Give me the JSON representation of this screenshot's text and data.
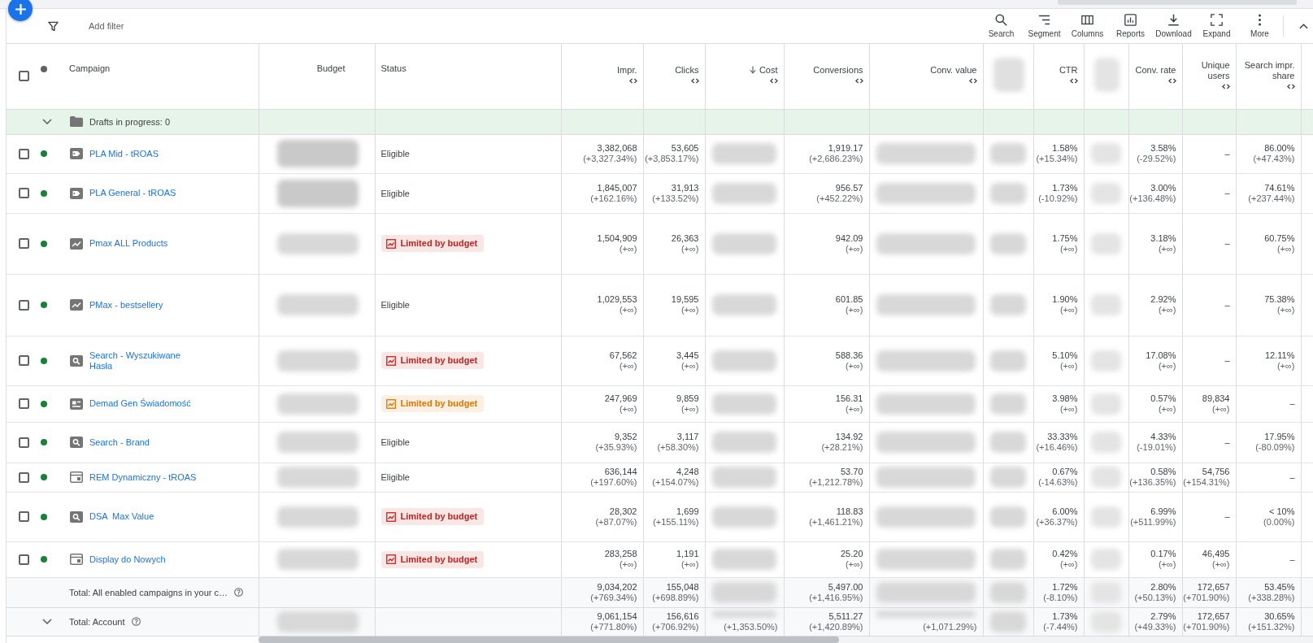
{
  "toolbar": {
    "filter": {
      "placeholder": "Add filter"
    },
    "actions": [
      {
        "kind": "search",
        "label": "Search"
      },
      {
        "kind": "segment",
        "label": "Segment"
      },
      {
        "kind": "columns",
        "label": "Columns"
      },
      {
        "kind": "reports",
        "label": "Reports"
      },
      {
        "kind": "download",
        "label": "Download"
      },
      {
        "kind": "expand",
        "label": "Expand"
      },
      {
        "kind": "more",
        "label": "More"
      }
    ]
  },
  "table": {
    "select_all": {
      "checked": false
    },
    "fixed_columns": [
      "Campaign",
      "Budget",
      "Status"
    ],
    "metric_columns": [
      {
        "label": "Impr.",
        "sorted": false
      },
      {
        "label": "Clicks",
        "sorted": false
      },
      {
        "label": "Cost",
        "sorted": true
      },
      {
        "label": "Conversions",
        "sorted": false
      },
      {
        "label": "Conv. value",
        "sorted": false
      },
      {
        "blurred": true
      },
      {
        "label": "CTR",
        "sorted": false
      },
      {
        "blurred": true
      },
      {
        "label": "Conv. rate",
        "sorted": false
      },
      {
        "label": "Unique users",
        "sorted": false
      },
      {
        "label": "Search impr. share",
        "sorted": false
      }
    ],
    "drafts": {
      "label": "Drafts in progress: 0"
    },
    "rows": [
      {
        "checked": false,
        "enabled": true,
        "kind": "shopping",
        "name": "PLA Mid - tROAS",
        "budget": {
          "blurred": true
        },
        "status": {
          "kind": "text",
          "text": "Eligible"
        },
        "metrics": [
          {
            "value": "3,382,068",
            "change": "(+3,327.34%)"
          },
          {
            "value": "53,605",
            "change": "(+3,853.17%)"
          },
          {
            "blurred": true
          },
          {
            "value": "1,919.17",
            "change": "(+2,686.23%)"
          },
          {
            "blurred": true
          },
          {
            "blurred": true
          },
          {
            "value": "1.58%",
            "change": "(+15.34%)"
          },
          {
            "blurred": true
          },
          {
            "value": "3.58%",
            "change": "(-29.52%)"
          },
          {
            "value": "–"
          },
          {
            "value": "86.00%",
            "change": "(+47.43%)"
          }
        ]
      },
      {
        "checked": false,
        "enabled": true,
        "kind": "shopping",
        "name": "PLA General - tROAS",
        "budget": {
          "blurred": true
        },
        "status": {
          "kind": "text",
          "text": "Eligible"
        },
        "metrics": [
          {
            "value": "1,845,007",
            "change": "(+162.16%)"
          },
          {
            "value": "31,913",
            "change": "(+133.52%)"
          },
          {
            "blurred": true
          },
          {
            "value": "956.57",
            "change": "(+452.22%)"
          },
          {
            "blurred": true
          },
          {
            "blurred": true
          },
          {
            "value": "1.73%",
            "change": "(-10.92%)"
          },
          {
            "blurred": true
          },
          {
            "value": "3.00%",
            "change": "(+136.48%)"
          },
          {
            "value": "–"
          },
          {
            "value": "74.61%",
            "change": "(+237.44%)"
          }
        ]
      },
      {
        "checked": false,
        "enabled": true,
        "kind": "performance_max",
        "name": "Pmax ALL Products",
        "budget": {
          "blurred": true
        },
        "status": {
          "kind": "badge",
          "text": "Limited by budget",
          "color": "#c5221f"
        },
        "metrics": [
          {
            "value": "1,504,909",
            "change": "(+∞)"
          },
          {
            "value": "26,363",
            "change": "(+∞)"
          },
          {
            "blurred": true
          },
          {
            "value": "942.09",
            "change": "(+∞)"
          },
          {
            "blurred": true
          },
          {
            "blurred": true
          },
          {
            "value": "1.75%",
            "change": "(+∞)"
          },
          {
            "blurred": true
          },
          {
            "value": "3.18%",
            "change": "(+∞)"
          },
          {
            "value": "–"
          },
          {
            "value": "60.75%",
            "change": "(+∞)"
          }
        ]
      },
      {
        "checked": false,
        "enabled": true,
        "kind": "performance_max",
        "name": "PMax - bestsellery",
        "budget": {
          "blurred": true
        },
        "status": {
          "kind": "text",
          "text": "Eligible"
        },
        "metrics": [
          {
            "value": "1,029,553",
            "change": "(+∞)"
          },
          {
            "value": "19,595",
            "change": "(+∞)"
          },
          {
            "blurred": true
          },
          {
            "value": "601.85",
            "change": "(+∞)"
          },
          {
            "blurred": true
          },
          {
            "blurred": true
          },
          {
            "value": "1.90%",
            "change": "(+∞)"
          },
          {
            "blurred": true
          },
          {
            "value": "2.92%",
            "change": "(+∞)"
          },
          {
            "value": "–"
          },
          {
            "value": "75.38%",
            "change": "(+∞)"
          }
        ]
      },
      {
        "checked": false,
        "enabled": true,
        "kind": "search",
        "name": "Search - Wyszukiwane Hasła",
        "budget": {
          "blurred": true
        },
        "status": {
          "kind": "badge",
          "text": "Limited by budget",
          "color": "#c5221f"
        },
        "metrics": [
          {
            "value": "67,562",
            "change": "(+∞)"
          },
          {
            "value": "3,445",
            "change": "(+∞)"
          },
          {
            "blurred": true
          },
          {
            "value": "588.36",
            "change": "(+∞)"
          },
          {
            "blurred": true
          },
          {
            "blurred": true
          },
          {
            "value": "5.10%",
            "change": "(+∞)"
          },
          {
            "blurred": true
          },
          {
            "value": "17.08%",
            "change": "(+∞)"
          },
          {
            "value": "–"
          },
          {
            "value": "12.11%",
            "change": "(+∞)"
          }
        ]
      },
      {
        "checked": false,
        "enabled": true,
        "kind": "demand_gen",
        "name": "Demad Gen Świadomość",
        "budget": {
          "blurred": true
        },
        "status": {
          "kind": "badge",
          "text": "Limited by budget",
          "color": "#e37400"
        },
        "metrics": [
          {
            "value": "247,969",
            "change": "(+∞)"
          },
          {
            "value": "9,859",
            "change": "(+∞)"
          },
          {
            "blurred": true
          },
          {
            "value": "156.31",
            "change": "(+∞)"
          },
          {
            "blurred": true
          },
          {
            "blurred": true
          },
          {
            "value": "3.98%",
            "change": "(+∞)"
          },
          {
            "blurred": true
          },
          {
            "value": "0.57%",
            "change": "(+∞)"
          },
          {
            "value": "89,834",
            "change": "(+∞)"
          },
          {
            "value": "–"
          }
        ]
      },
      {
        "checked": false,
        "enabled": true,
        "kind": "search",
        "name": "Search - Brand",
        "budget": {
          "blurred": true
        },
        "status": {
          "kind": "text",
          "text": "Eligible"
        },
        "metrics": [
          {
            "value": "9,352",
            "change": "(+35.93%)"
          },
          {
            "value": "3,117",
            "change": "(+58.30%)"
          },
          {
            "blurred": true
          },
          {
            "value": "134.92",
            "change": "(+28.21%)"
          },
          {
            "blurred": true
          },
          {
            "blurred": true
          },
          {
            "value": "33.33%",
            "change": "(+16.46%)"
          },
          {
            "blurred": true
          },
          {
            "value": "4.33%",
            "change": "(-19.01%)"
          },
          {
            "value": "–"
          },
          {
            "value": "17.95%",
            "change": "(-80.09%)"
          }
        ]
      },
      {
        "checked": false,
        "enabled": true,
        "kind": "display",
        "name": "REM Dynamiczny - tROAS",
        "budget": {
          "blurred": true
        },
        "status": {
          "kind": "text",
          "text": "Eligible"
        },
        "metrics": [
          {
            "value": "636,144",
            "change": "(+197.60%)"
          },
          {
            "value": "4,248",
            "change": "(+154.07%)"
          },
          {
            "blurred": true
          },
          {
            "value": "53.70",
            "change": "(+1,212.78%)"
          },
          {
            "blurred": true
          },
          {
            "blurred": true
          },
          {
            "value": "0.67%",
            "change": "(-14.63%)"
          },
          {
            "blurred": true
          },
          {
            "value": "0.58%",
            "change": "(+136.35%)"
          },
          {
            "value": "54,756",
            "change": "(+154.31%)"
          },
          {
            "value": "–"
          }
        ]
      },
      {
        "checked": false,
        "enabled": true,
        "kind": "search",
        "name": "DSA  Max Value",
        "budget": {
          "blurred": true
        },
        "status": {
          "kind": "badge",
          "text": "Limited by budget",
          "color": "#c5221f"
        },
        "metrics": [
          {
            "value": "28,302",
            "change": "(+87.07%)"
          },
          {
            "value": "1,699",
            "change": "(+155.11%)"
          },
          {
            "blurred": true
          },
          {
            "value": "118.83",
            "change": "(+1,461.21%)"
          },
          {
            "blurred": true
          },
          {
            "blurred": true
          },
          {
            "value": "6.00%",
            "change": "(+36.37%)"
          },
          {
            "blurred": true
          },
          {
            "value": "6.99%",
            "change": "(+511.99%)"
          },
          {
            "value": "–"
          },
          {
            "value": "< 10%",
            "change": "(0.00%)"
          }
        ]
      },
      {
        "checked": false,
        "enabled": true,
        "kind": "display",
        "name": "Display do Nowych",
        "budget": {
          "blurred": true
        },
        "status": {
          "kind": "badge",
          "text": "Limited by budget",
          "color": "#c5221f"
        },
        "metrics": [
          {
            "value": "283,258",
            "change": "(+∞)"
          },
          {
            "value": "1,191",
            "change": "(+∞)"
          },
          {
            "blurred": true
          },
          {
            "value": "25.20",
            "change": "(+∞)"
          },
          {
            "blurred": true
          },
          {
            "blurred": true
          },
          {
            "value": "0.42%",
            "change": "(+∞)"
          },
          {
            "blurred": true
          },
          {
            "value": "0.17%",
            "change": "(+∞)"
          },
          {
            "value": "46,495",
            "change": "(+∞)"
          },
          {
            "value": "–"
          }
        ]
      }
    ],
    "totals": [
      {
        "kind": "enabled",
        "label": "Total: All enabled campaigns in your c…",
        "metrics": [
          {
            "value": "9,034,202",
            "change": "(+769.34%)"
          },
          {
            "value": "155,048",
            "change": "(+698.89%)"
          },
          {
            "blurred": true
          },
          {
            "value": "5,497.00",
            "change": "(+1,416.95%)"
          },
          {
            "blurred": true
          },
          {
            "blurred": true
          },
          {
            "value": "1.72%",
            "change": "(-8.10%)"
          },
          {
            "blurred": true
          },
          {
            "value": "2.80%",
            "change": "(+50.13%)"
          },
          {
            "value": "172,657",
            "change": "(+701.90%)"
          },
          {
            "value": "53.45%",
            "change": "(+338.28%)"
          }
        ]
      },
      {
        "kind": "account",
        "label": "Total: Account",
        "budget": {
          "blurred": true
        },
        "metrics": [
          {
            "value": "9,061,154",
            "change": "(+771.80%)"
          },
          {
            "value": "156,616",
            "change": "(+706.92%)"
          },
          {
            "blurred": true,
            "change": "(+1,353.50%)"
          },
          {
            "value": "5,511.27",
            "change": "(+1,420.89%)"
          },
          {
            "blurred": true,
            "change": "(+1,071.29%)"
          },
          {
            "blurred": true
          },
          {
            "value": "1.73%",
            "change": "(-7.44%)"
          },
          {
            "blurred": true
          },
          {
            "value": "2.79%",
            "change": "(+49.33%)"
          },
          {
            "value": "172,657",
            "change": "(+701.90%)"
          },
          {
            "value": "30.65%",
            "change": "(+151.32%)"
          }
        ]
      }
    ]
  }
}
